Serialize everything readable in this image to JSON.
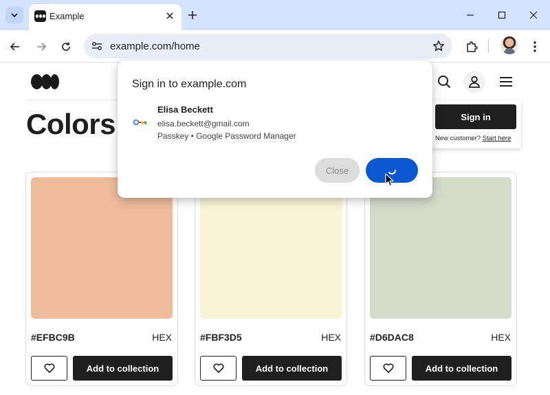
{
  "browser": {
    "tab_title": "Example",
    "url": "example.com/home"
  },
  "page": {
    "title": "Colors",
    "account_popup": {
      "sign_in_label": "Sign in",
      "new_customer_text": "New customer?",
      "start_here_link": "Start here"
    },
    "cards": [
      {
        "hex": "#EFBC9B",
        "hex_label": "HEX",
        "color": "#EFBC9B",
        "add_label": "Add to collection"
      },
      {
        "hex": "#FBF3D5",
        "hex_label": "HEX",
        "color": "#FBF3D5",
        "add_label": "Add to collection"
      },
      {
        "hex": "#D6DAC8",
        "hex_label": "HEX",
        "color": "#D6DAC8",
        "add_label": "Add to collection"
      }
    ]
  },
  "dialog": {
    "title": "Sign in to example.com",
    "account_name": "Elisa Beckett",
    "account_email": "elisa.beckett@gmail.com",
    "account_source": "Passkey • Google Password Manager",
    "close_label": "Close",
    "continue_state": "loading"
  },
  "colors": {
    "chrome_tabstrip": "#d3e3fd",
    "accent_blue": "#0b57d0",
    "dark_button": "#1f1f1f"
  }
}
